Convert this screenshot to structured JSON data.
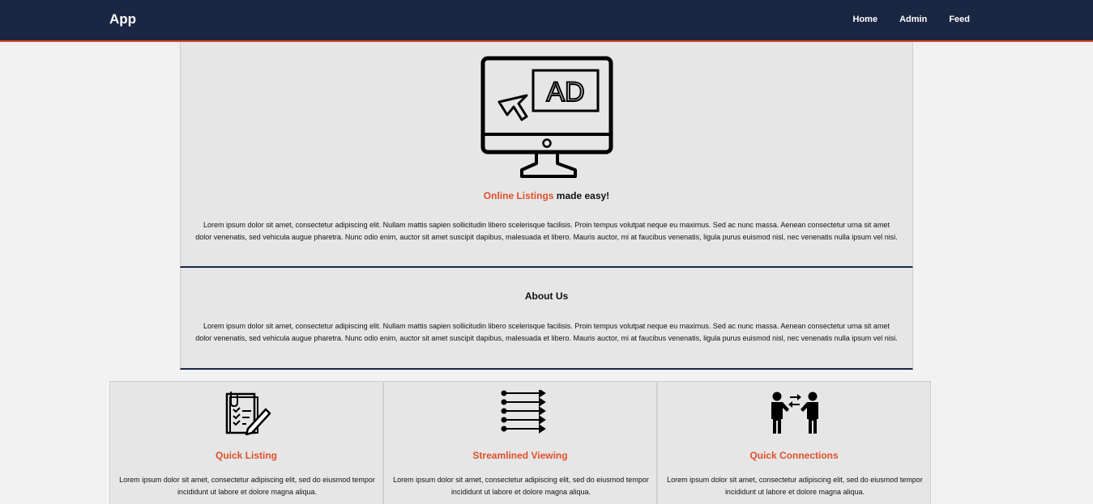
{
  "navbar": {
    "brand": "App",
    "links": [
      "Home",
      "Admin",
      "Feed"
    ]
  },
  "colors": {
    "navbar_bg": "#1a2742",
    "accent": "#e0502b",
    "panel_bg": "#e6e6e6",
    "page_bg": "#f3f2f2"
  },
  "hero": {
    "icon": "computer-monitor-ad-icon",
    "monitor_text": "AD",
    "title_highlight": "Online Listings",
    "title_rest": " made easy!",
    "paragraph": "Lorem ipsum dolor sit amet, consectetur adipiscing elit. Nullam mattis sapien sollicitudin libero scelerisque facilisis. Proin tempus volutpat neque eu maximus. Sed ac nunc massa. Aenean consectetur urna sit amet dolor venenatis, sed vehicula augue pharetra. Nunc odio enim, auctor sit amet suscipit dapibus, malesuada et libero. Mauris auctor, mi at faucibus venenatis, ligula purus euismod nisl, nec venenatis nulla ipsum vel nisi."
  },
  "about": {
    "title": "About Us",
    "paragraph": "Lorem ipsum dolor sit amet, consectetur adipiscing elit. Nullam mattis sapien sollicitudin libero scelerisque facilisis. Proin tempus volutpat neque eu maximus. Sed ac nunc massa. Aenean consectetur urna sit amet dolor venenatis, sed vehicula augue pharetra. Nunc odio enim, auctor sit amet suscipit dapibus, malesuada et libero. Mauris auctor, mi at faucibus venenatis, ligula purus euismod nisl, nec venenatis nulla ipsum vel nisi."
  },
  "features": [
    {
      "icon": "clipboard-checklist-icon",
      "title": "Quick Listing",
      "text": "Lorem ipsum dolor sit amet, consectetur adipiscing elit, sed do eiusmod tempor incididunt ut labore et dolore magna aliqua."
    },
    {
      "icon": "arrows-list-icon",
      "title": "Streamlined Viewing",
      "text": "Lorem ipsum dolor sit amet, consectetur adipiscing elit, sed do eiusmod tempor incididunt ut labore et dolore magna aliqua."
    },
    {
      "icon": "people-exchange-icon",
      "title": "Quick Connections",
      "text": "Lorem ipsum dolor sit amet, consectetur adipiscing elit, sed do eiusmod tempor incididunt ut labore et dolore magna aliqua."
    }
  ]
}
